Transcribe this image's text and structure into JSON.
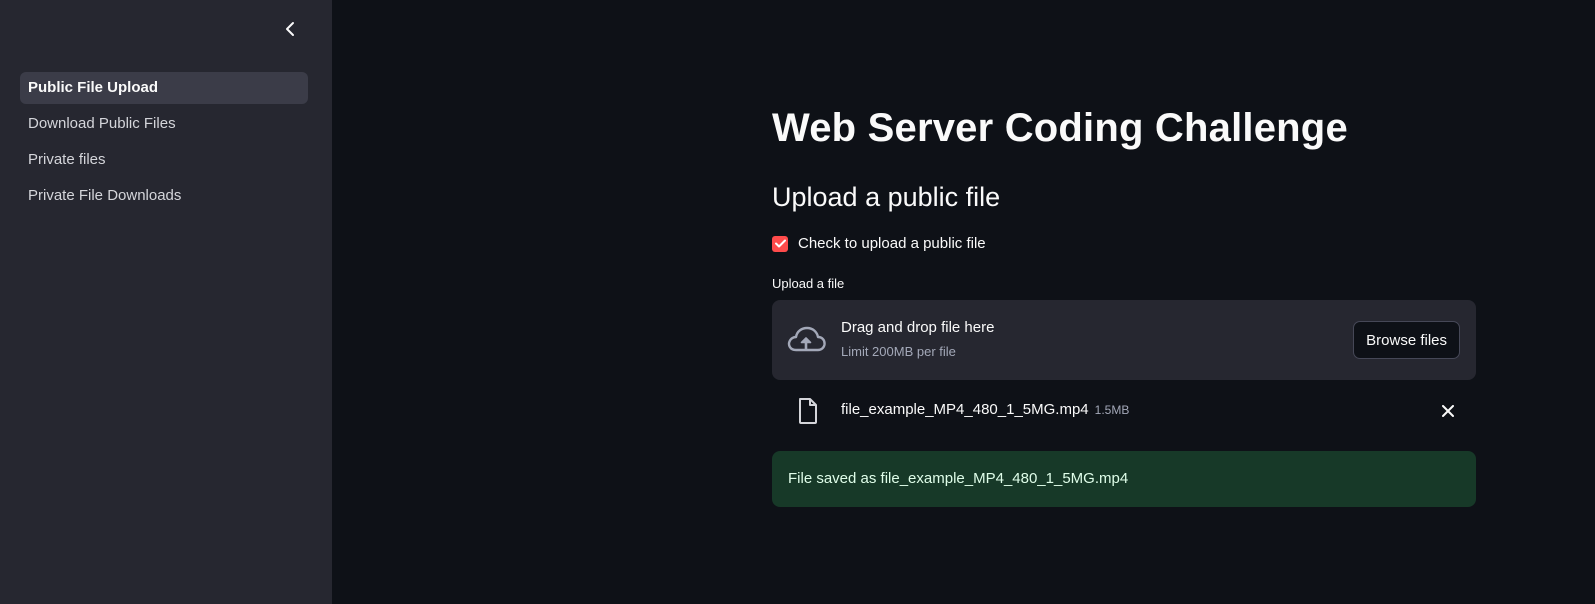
{
  "sidebar": {
    "items": [
      {
        "label": "Public File Upload"
      },
      {
        "label": "Download Public Files"
      },
      {
        "label": "Private files"
      },
      {
        "label": "Private File Downloads"
      }
    ]
  },
  "main": {
    "title": "Web Server Coding Challenge",
    "subheader": "Upload a public file",
    "checkbox": {
      "label": "Check to upload a public file",
      "checked": true
    },
    "uploader": {
      "label": "Upload a file",
      "drop_text": "Drag and drop file here",
      "limit_text": "Limit 200MB per file",
      "browse_label": "Browse files"
    },
    "uploaded_file": {
      "name": "file_example_MP4_480_1_5MG.mp4",
      "size": "1.5MB"
    },
    "success_message": "File saved as file_example_MP4_480_1_5MG.mp4"
  },
  "colors": {
    "accent": "#ff4b4b",
    "sidebar_bg": "#262730",
    "main_bg": "#0e1117",
    "success_bg": "#173928"
  },
  "icons": [
    "chevron-left-icon",
    "check-icon",
    "cloud-upload-icon",
    "file-icon",
    "close-icon"
  ]
}
